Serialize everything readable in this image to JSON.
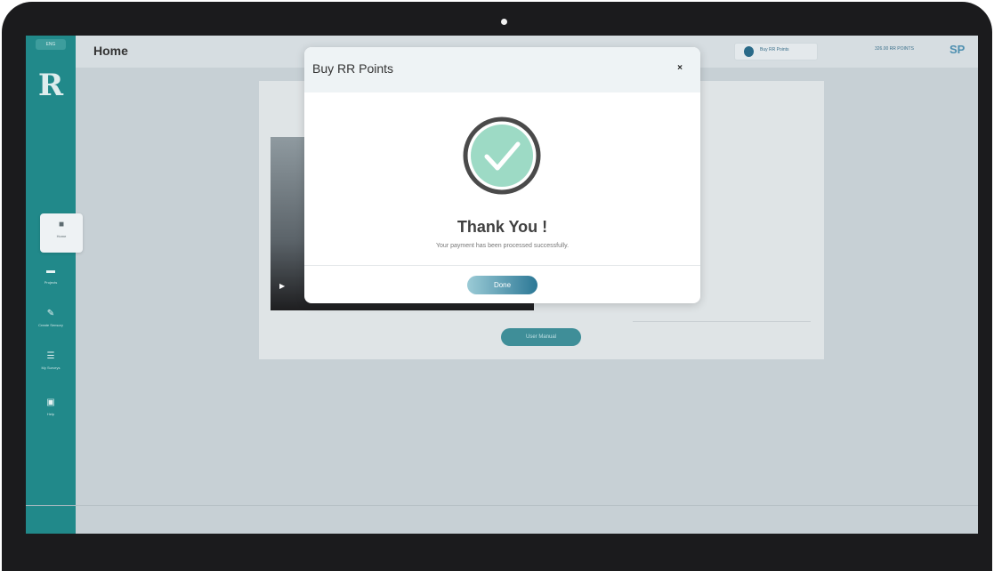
{
  "header": {
    "language": "ENG",
    "page_title": "Home",
    "buy_points_label": "Buy RR Points",
    "points_balance": "326.00 RR POINTS",
    "avatar_initials": "SP"
  },
  "sidebar": {
    "logo_text": "R",
    "items": [
      {
        "label": "Home",
        "icon": "home-icon"
      },
      {
        "label": "Projects",
        "icon": "folder-icon"
      },
      {
        "label": "Create Sensory",
        "icon": "pencil-icon"
      },
      {
        "label": "My Surveys",
        "icon": "list-icon"
      },
      {
        "label": "Help",
        "icon": "help-icon"
      }
    ]
  },
  "content": {
    "user_manual_label": "User Manual"
  },
  "modal": {
    "title": "Buy RR Points",
    "close_symbol": "×",
    "heading": "Thank You !",
    "message": "Your payment has been processed successfully.",
    "done_label": "Done",
    "colors": {
      "check_fill": "#9ddac5",
      "check_ring": "#4a4a4a",
      "done_start": "#9bcbd6",
      "done_end": "#2c7896"
    }
  }
}
